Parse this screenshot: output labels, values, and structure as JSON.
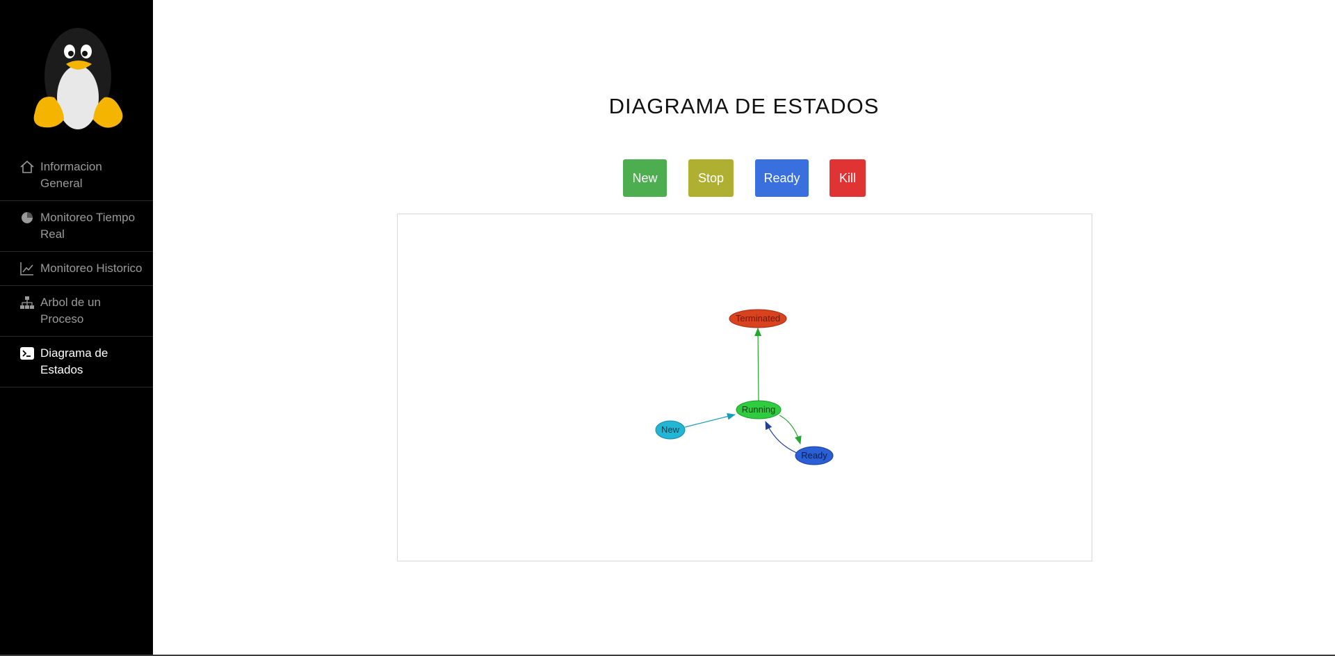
{
  "sidebar": {
    "items": [
      {
        "label": "Informacion General",
        "icon": "home-icon",
        "active": false
      },
      {
        "label": "Monitoreo Tiempo Real",
        "icon": "pie-chart-icon",
        "active": false
      },
      {
        "label": "Monitoreo Historico",
        "icon": "line-chart-icon",
        "active": false
      },
      {
        "label": "Arbol de un Proceso",
        "icon": "sitemap-icon",
        "active": false
      },
      {
        "label": "Diagrama de Estados",
        "icon": "terminal-icon",
        "active": true
      }
    ]
  },
  "main": {
    "title": "DIAGRAMA DE ESTADOS",
    "buttons": {
      "new": {
        "label": "New",
        "color": "#4cae4f"
      },
      "stop": {
        "label": "Stop",
        "color": "#afaf32"
      },
      "ready": {
        "label": "Ready",
        "color": "#3a6fde"
      },
      "kill": {
        "label": "Kill",
        "color": "#e03434"
      }
    }
  },
  "diagram": {
    "nodes": {
      "terminated": {
        "label": "Terminated",
        "fill": "#d9421e"
      },
      "running": {
        "label": "Running",
        "fill": "#2ecc3e"
      },
      "new": {
        "label": "New",
        "fill": "#22b6d4"
      },
      "ready": {
        "label": "Ready",
        "fill": "#2a5fd6"
      }
    },
    "edges": [
      {
        "from": "New",
        "to": "Running",
        "color": "#1a9db8"
      },
      {
        "from": "Running",
        "to": "Terminated",
        "color": "#22a82e"
      },
      {
        "from": "Running",
        "to": "Ready",
        "color": "#22a82e"
      },
      {
        "from": "Ready",
        "to": "Running",
        "color": "#1f3f9e"
      }
    ]
  }
}
